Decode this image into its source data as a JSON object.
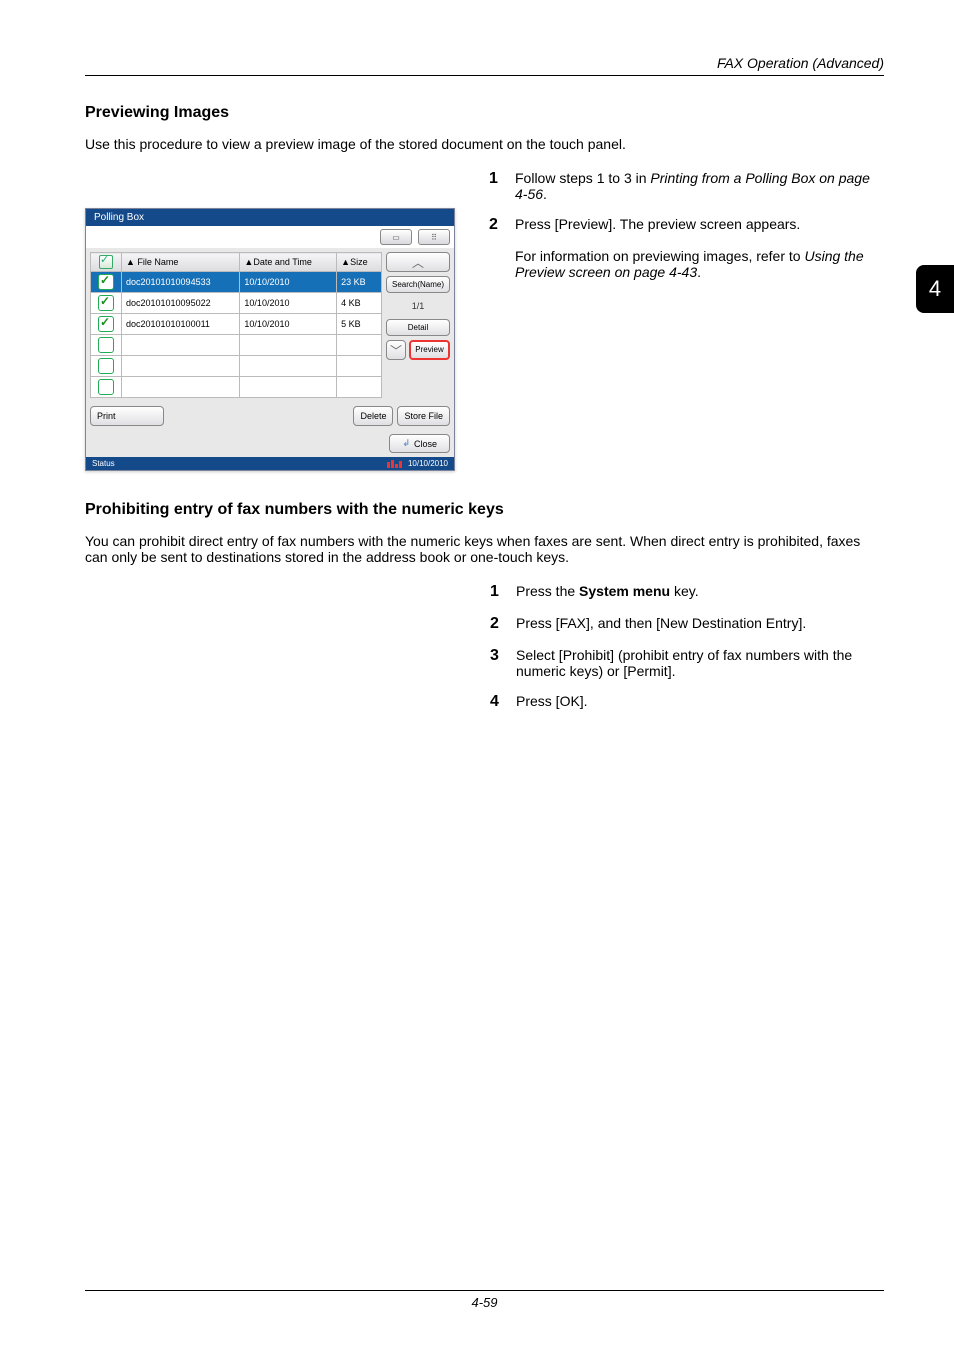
{
  "running_head": "FAX Operation (Advanced)",
  "sidetab": "4",
  "footer_pn": "4-59",
  "sec1": {
    "title": "Previewing Images",
    "intro": "Use this procedure to view a preview image of the stored document on the touch panel.",
    "step1": "Follow steps 1 to 3 in Printing from a Polling Box on page 4-56.",
    "step2": "Press [Preview]. The preview screen appears.",
    "sub2": "For information on previewing images, refer to Using the Preview screen on page 4-43."
  },
  "panel": {
    "title": "Polling Box",
    "headers": {
      "name": "File Name",
      "date": "Date and Time",
      "size": "Size"
    },
    "rows": [
      {
        "chk": true,
        "sel": true,
        "name": "doc20101010094533",
        "date": "10/10/2010",
        "size": "23 KB"
      },
      {
        "chk": true,
        "sel": false,
        "name": "doc20101010095022",
        "date": "10/10/2010",
        "size": "4 KB"
      },
      {
        "chk": true,
        "sel": false,
        "name": "doc20101010100011",
        "date": "10/10/2010",
        "size": "5 KB"
      },
      {
        "chk": false,
        "sel": false,
        "name": "",
        "date": "",
        "size": ""
      },
      {
        "chk": false,
        "sel": false,
        "name": "",
        "date": "",
        "size": ""
      },
      {
        "chk": false,
        "sel": false,
        "name": "",
        "date": "",
        "size": ""
      }
    ],
    "btn_search": "Search(Name)",
    "page_ind": "1/1",
    "btn_detail": "Detail",
    "btn_preview": "Preview",
    "btn_print": "Print",
    "btn_delete": "Delete",
    "btn_store": "Store File",
    "btn_close": "Close",
    "status": "Status",
    "status_date": "10/10/2010"
  },
  "sec2": {
    "title": "Prohibiting entry of fax numbers with the numeric keys",
    "intro": "You can prohibit direct entry of fax numbers with the numeric keys when faxes are sent. When direct entry is prohibited, faxes can only be sent to destinations stored in the address book or one-touch keys.",
    "step1_pre": "Press the ",
    "step1_bold": "System menu",
    "step1_post": " key.",
    "step2": "Press [FAX], and then [New Destination Entry].",
    "step3": "Select [Prohibit] (prohibit entry of fax numbers with the numeric keys) or [Permit].",
    "step4": "Press [OK]."
  }
}
